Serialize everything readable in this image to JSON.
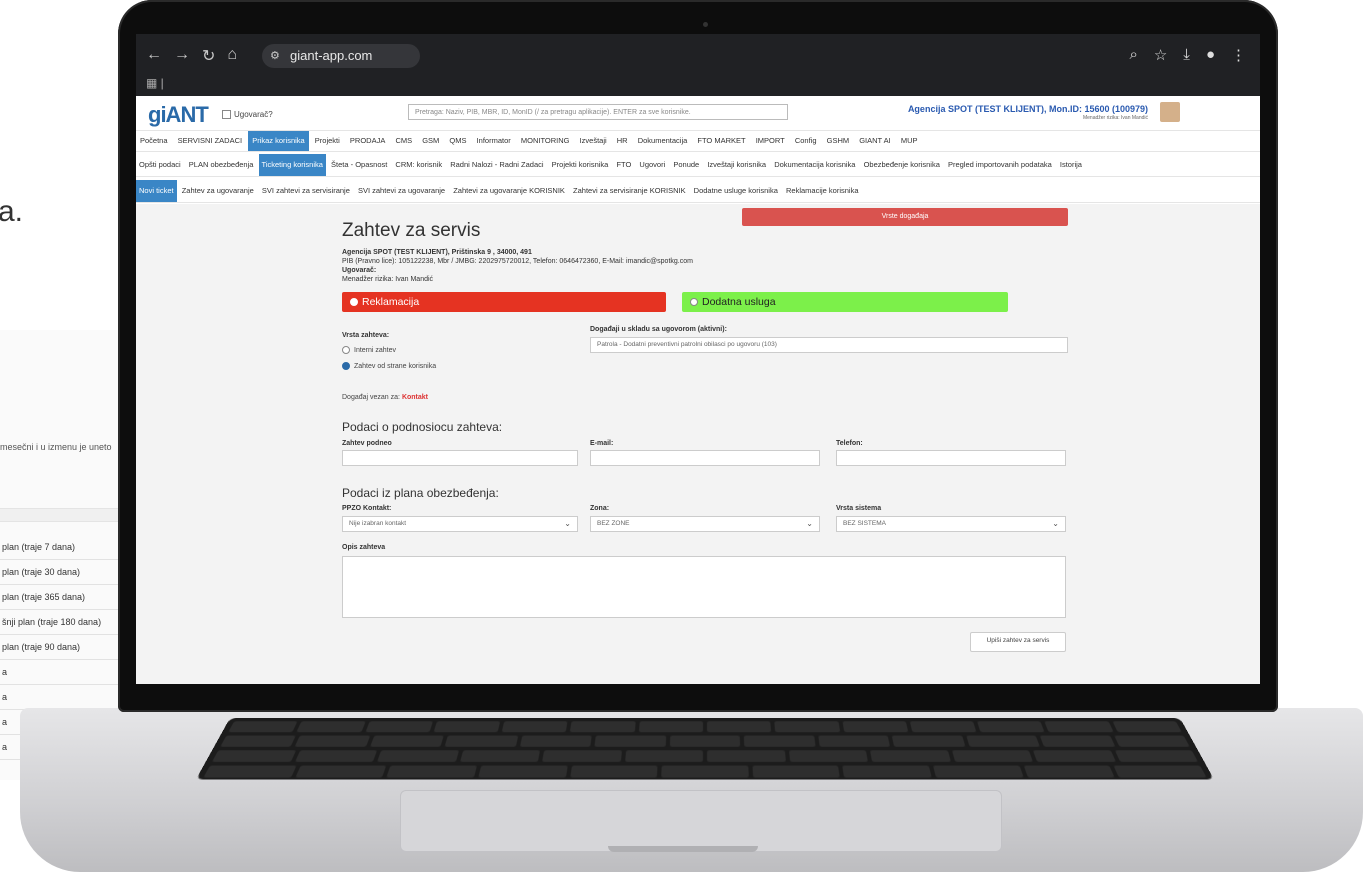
{
  "background": {
    "partial_word": "a.",
    "partial_line": "mesečni i u izmenu je uneto",
    "list_rows": [
      "plan (traje 7 dana)",
      "plan (traje 30 dana)",
      "plan (traje 365 dana)",
      "šnji plan (traje 180 dana)",
      "plan (traje 90 dana)",
      "a",
      "a",
      "a",
      "a"
    ]
  },
  "browser": {
    "url": "giant-app.com",
    "nav": {
      "back": "←",
      "forward": "→",
      "reload": "↻",
      "home": "⌂"
    },
    "icons_right": [
      "zoom-icon",
      "star-icon",
      "download-icon",
      "profile-icon",
      "menu-icon"
    ]
  },
  "header": {
    "logo": "giANT",
    "ugovarac_label": "Ugovarač?",
    "search_placeholder": "Pretraga: Naziv, PIB, MBR, ID, MonID (/ za pretragu aplikacije). ENTER za sve korisnike.",
    "agency": "Agencija SPOT (TEST KLIJENT), Mon.ID: 15600 (100979)",
    "agency_sub": "Menadžer rizika: Ivan Mandić"
  },
  "main_menu": [
    "Početna",
    "SERVISNI ZADACI",
    "Prikaz korisnika",
    "Projekti",
    "PRODAJA",
    "CMS",
    "GSM",
    "QMS",
    "Informator",
    "MONITORING",
    "Izveštaji",
    "HR",
    "Dokumentacija",
    "FTO MARKET",
    "IMPORT",
    "Config",
    "GSHM",
    "GIANT AI",
    "MUP"
  ],
  "sub_menu": [
    "Opšti podaci",
    "PLAN obezbeđenja",
    "Ticketing korisnika",
    "Šteta - Opasnost",
    "CRM: korisnik",
    "Radni Nalozi - Radni Zadaci",
    "Projekti korisnika",
    "FTO",
    "Ugovori",
    "Ponude",
    "Izveštaji korisnika",
    "Dokumentacija korisnika",
    "Obezbeđenje korisnika",
    "Pregled importovanih podataka",
    "Istorija"
  ],
  "sub_menu2": [
    "Novi ticket",
    "Zahtev za ugovaranje",
    "SVI zahtevi za servisiranje",
    "SVI zahtevi za ugovaranje",
    "Zahtevi za ugovaranje KORISNIK",
    "Zahtevi za servisiranje KORISNIK",
    "Dodatne usluge korisnika",
    "Reklamacije korisnika"
  ],
  "form": {
    "title": "Zahtev za servis",
    "history_button": "Vrste događaja",
    "info_line1": "Agencija SPOT (TEST KLIJENT), Prištinska 9 , 34000, 491",
    "info_line2": "PIB (Pravno lice): 105122238, Mbr / JMBG: 2202975720012, Telefon: 0646472360, E-Mail: imandic@spotkg.com",
    "info_line3": "Ugovarač:",
    "info_line4": "Menadžer rizika: Ivan Mandić",
    "option_reklamacija": "Reklamacija",
    "option_dodatna": "Dodatna usluga",
    "vrsta_label": "Vrsta zahteva:",
    "vrsta_opt1": "Interni zahtev",
    "vrsta_opt2": "Zahtev od strane korisnika",
    "dogadjaji_label": "Događaji u skladu sa ugovorom (aktivni):",
    "dogadjaji_value": "Patrola - Dodatni preventivni patrolni obilasci po ugovoru (103)",
    "vezan_label": "Događaj vezan za:",
    "vezan_value": "Kontakt",
    "section1": "Podaci o podnosiocu zahteva:",
    "zahtev_podneo": "Zahtev podneo",
    "email": "E-mail:",
    "telefon": "Telefon:",
    "section2": "Podaci iz plana obezbeđenja:",
    "ppzo_label": "PPZO Kontakt:",
    "ppzo_value": "Nije izabran kontakt",
    "zona_label": "Zona:",
    "zona_value": "BEZ ZONE",
    "sistem_label": "Vrsta sistema",
    "sistem_value": "BEZ SISTEMA",
    "opis_label": "Opis zahteva",
    "submit": "Upiši zahtev za servis"
  },
  "colors": {
    "accent": "#3a86c6",
    "reklamacija": "#e53322",
    "dodatna": "#7cf04a",
    "history": "#d9534f"
  }
}
